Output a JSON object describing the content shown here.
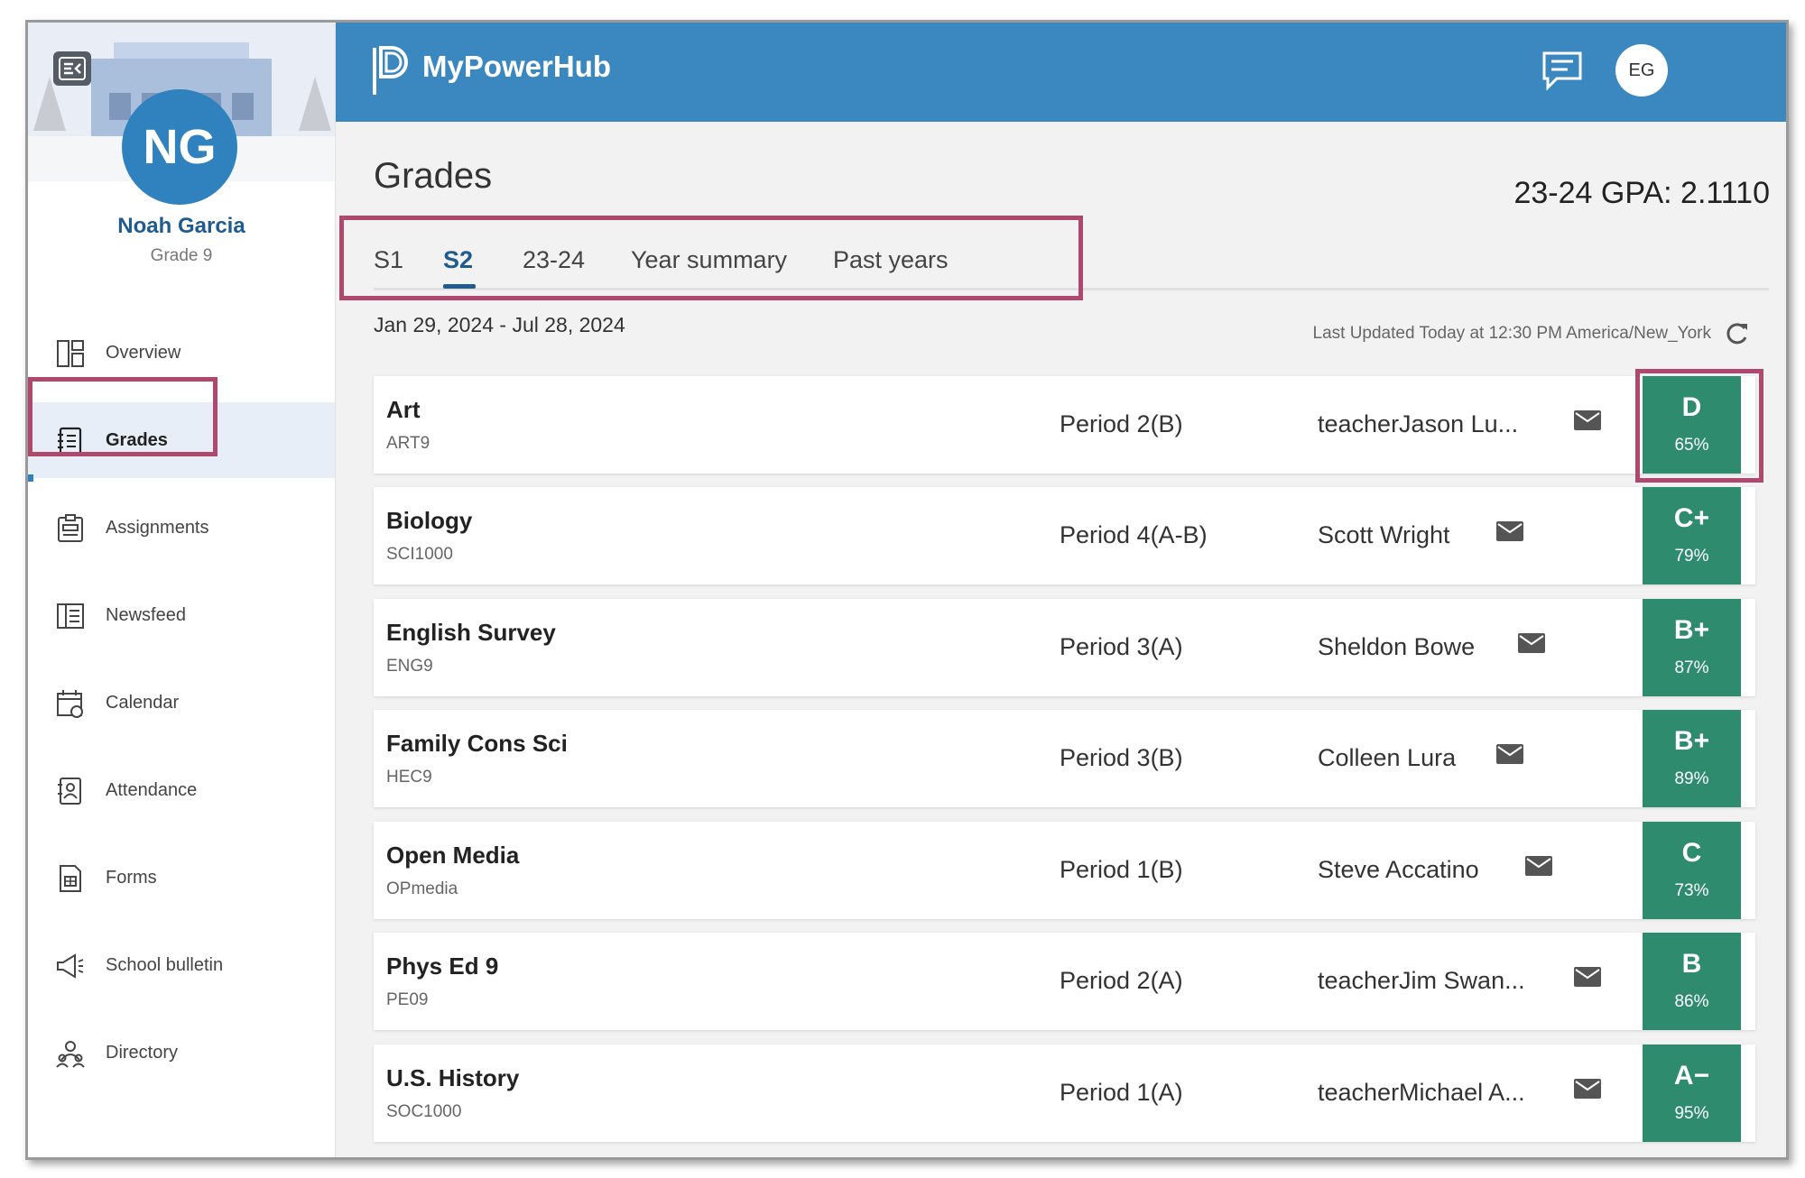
{
  "app": {
    "title": "MyPowerHub",
    "user_initials": "EG"
  },
  "student": {
    "initials": "NG",
    "name": "Noah Garcia",
    "grade_level": "Grade 9"
  },
  "sidebar": {
    "items": [
      {
        "label": "Overview",
        "icon": "dashboard-icon"
      },
      {
        "label": "Grades",
        "icon": "gradebook-icon",
        "active": true
      },
      {
        "label": "Assignments",
        "icon": "clipboard-icon"
      },
      {
        "label": "Newsfeed",
        "icon": "newsfeed-icon"
      },
      {
        "label": "Calendar",
        "icon": "calendar-icon"
      },
      {
        "label": "Attendance",
        "icon": "attendance-icon"
      },
      {
        "label": "Forms",
        "icon": "forms-icon"
      },
      {
        "label": "School bulletin",
        "icon": "megaphone-icon"
      },
      {
        "label": "Directory",
        "icon": "people-icon"
      }
    ]
  },
  "main": {
    "title": "Grades",
    "gpa": "23-24 GPA: 2.1110",
    "tabs": [
      {
        "label": "S1"
      },
      {
        "label": "S2",
        "selected": true
      },
      {
        "label": "23-24"
      },
      {
        "label": "Year summary"
      },
      {
        "label": "Past years"
      }
    ],
    "date_range": "Jan 29, 2024 - Jul 28, 2024",
    "last_updated": "Last Updated Today at 12:30 PM America/New_York"
  },
  "courses": [
    {
      "name": "Art",
      "code": "ART9",
      "period": "Period 2(B)",
      "teacher": "teacherJason Lu...",
      "letter": "D",
      "percent": "65%"
    },
    {
      "name": "Biology",
      "code": "SCI1000",
      "period": "Period 4(A-B)",
      "teacher": "Scott Wright",
      "letter": "C+",
      "percent": "79%"
    },
    {
      "name": "English Survey",
      "code": "ENG9",
      "period": "Period 3(A)",
      "teacher": "Sheldon Bowe",
      "letter": "B+",
      "percent": "87%"
    },
    {
      "name": "Family Cons Sci",
      "code": "HEC9",
      "period": "Period 3(B)",
      "teacher": "Colleen Lura",
      "letter": "B+",
      "percent": "89%"
    },
    {
      "name": "Open Media",
      "code": "OPmedia",
      "period": "Period 1(B)",
      "teacher": "Steve Accatino",
      "letter": "C",
      "percent": "73%"
    },
    {
      "name": "Phys Ed 9",
      "code": "PE09",
      "period": "Period 2(A)",
      "teacher": "teacherJim Swan...",
      "letter": "B",
      "percent": "86%"
    },
    {
      "name": "U.S. History",
      "code": "SOC1000",
      "period": "Period 1(A)",
      "teacher": "teacherMichael A...",
      "letter": "A−",
      "percent": "95%"
    }
  ],
  "colors": {
    "header": "#3b87bf",
    "grade_badge": "#2e8b6e",
    "accent": "#1f5b8e",
    "highlight": "#b0476c"
  }
}
